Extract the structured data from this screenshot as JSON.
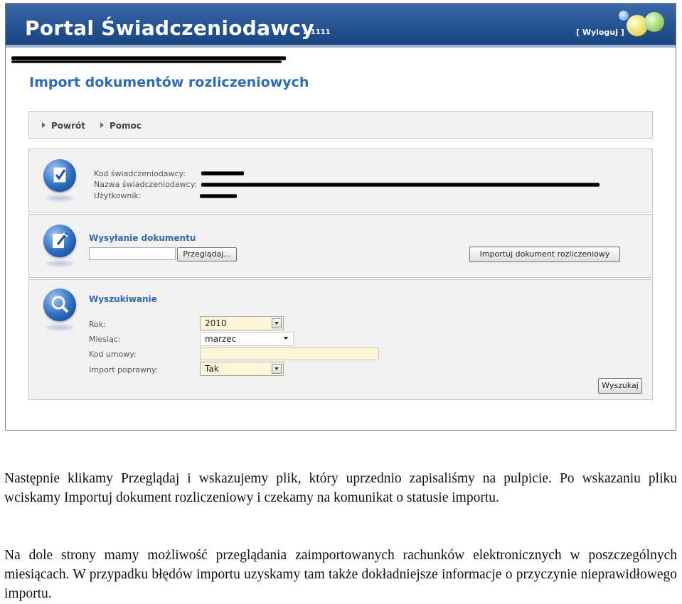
{
  "banner": {
    "title": "Portal Świadczeniodawcy",
    "version": "2.1111",
    "logout_label": "[ Wyloguj ]"
  },
  "page_title": "Import dokumentów rozliczeniowych",
  "nav": {
    "back_label": "Powrót",
    "help_label": "Pomoc"
  },
  "provider_info": {
    "code_label": "Kod świadczeniodawcy:",
    "name_label": "Nazwa świadczeniodawcy:",
    "user_label": "Użytkownik:"
  },
  "upload": {
    "title": "Wysyłanie dokumentu",
    "file_value": "",
    "browse_label": "Przeglądaj...",
    "import_label": "Importuj dokument rozliczeniowy"
  },
  "search": {
    "title": "Wyszukiwanie",
    "year_label": "Rok:",
    "year_value": "2010",
    "month_label": "Miesiąc:",
    "month_value": "marzec",
    "contract_label": "Kod umowy:",
    "contract_value": "",
    "import_ok_label": "Import poprawny:",
    "import_ok_value": "Tak",
    "search_button_label": "Wyszukaj"
  },
  "paragraphs": [
    "Następnie klikamy Przeglądaj i wskazujemy plik, który uprzednio zapisaliśmy na pulpicie. Po wskazaniu pliku wciskamy Importuj dokument rozliczeniowy i czekamy na komunikat o statusie importu.",
    "Na dole strony mamy możliwość przeglądania zaimportowanych rachunków elektronicznych w poszczególnych miesiącach. W przypadku błędów importu uzyskamy tam także dokładniejsze informacje o przyczynie nieprawidłowego importu."
  ],
  "colors": {
    "banner": "#23508f",
    "accent": "#2f6bb0",
    "panel_bg": "#f1f1f1",
    "field_bg": "#fff6d9"
  },
  "icons": [
    "document-check-icon",
    "document-edit-icon",
    "magnifier-icon",
    "chevron-right-icon",
    "dropdown-arrow-icon"
  ]
}
